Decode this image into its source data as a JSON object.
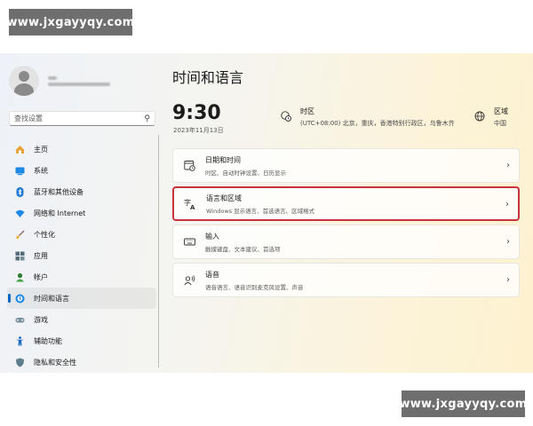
{
  "watermark": {
    "text": "www.jxgayyqy.com"
  },
  "sidebar": {
    "search_placeholder": "查找设置",
    "items": [
      {
        "label": "主页",
        "icon": "home-icon"
      },
      {
        "label": "系统",
        "icon": "monitor-icon"
      },
      {
        "label": "蓝牙和其他设备",
        "icon": "bluetooth-icon"
      },
      {
        "label": "网络和 Internet",
        "icon": "wifi-icon"
      },
      {
        "label": "个性化",
        "icon": "brush-icon"
      },
      {
        "label": "应用",
        "icon": "apps-icon"
      },
      {
        "label": "帐户",
        "icon": "account-icon"
      },
      {
        "label": "时间和语言",
        "icon": "globe-clock-icon",
        "active": true
      },
      {
        "label": "游戏",
        "icon": "gamepad-icon"
      },
      {
        "label": "辅助功能",
        "icon": "accessibility-icon"
      },
      {
        "label": "隐私和安全性",
        "icon": "shield-icon"
      }
    ]
  },
  "main": {
    "title": "时间和语言",
    "time": "9:30",
    "date": "2023年11月13日",
    "timezone": {
      "title": "时区",
      "value": "(UTC+08:00) 北京，重庆，香港特别行政区，乌鲁木齐"
    },
    "region": {
      "title": "区域",
      "value": "中国"
    },
    "cards": [
      {
        "title": "日期和时间",
        "subtitle": "时区、自动时钟设置、日历显示",
        "icon": "calendar-clock-icon"
      },
      {
        "title": "语言和区域",
        "subtitle": "Windows 显示语言、首选语言、区域格式",
        "icon": "language-icon",
        "highlighted": true
      },
      {
        "title": "输入",
        "subtitle": "触摸键盘、文本建议、首选项",
        "icon": "keyboard-icon"
      },
      {
        "title": "语音",
        "subtitle": "语音语言、语音识别麦克风设置、声音",
        "icon": "speech-icon"
      }
    ]
  },
  "colors": {
    "accent": "#0067c0",
    "highlight_border": "#c8323a",
    "watermark_bg": "#6e6e6e"
  }
}
